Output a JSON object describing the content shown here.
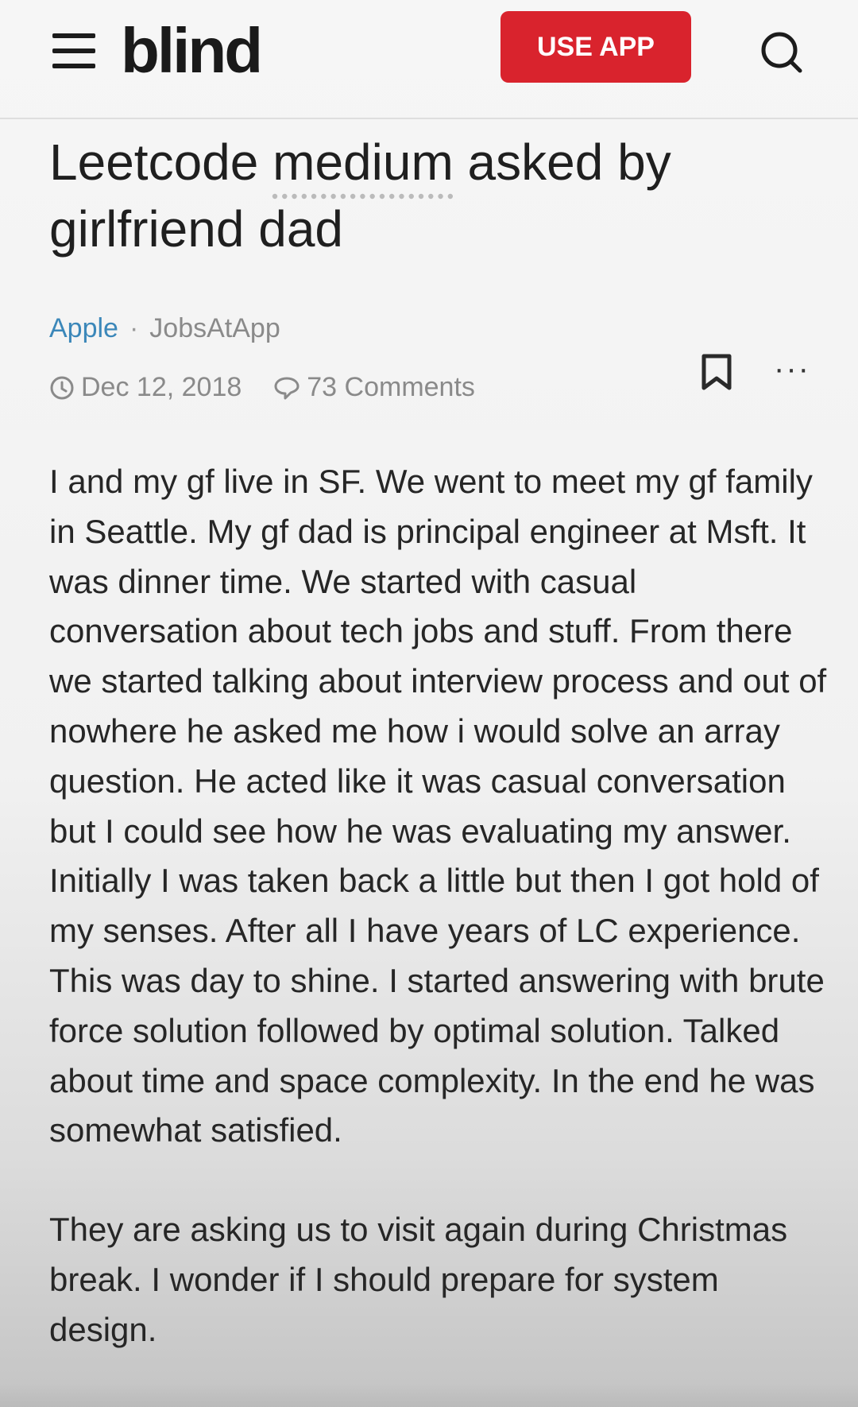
{
  "header": {
    "logo": "blind",
    "use_app_label": "USE APP"
  },
  "post": {
    "title_part1": "Leetcode ",
    "title_dotted": "medium",
    "title_part2": " asked by girlfriend dad",
    "company": "Apple",
    "separator": "·",
    "author": "JobsAtApp",
    "date": "Dec 12, 2018",
    "comments": "73 Comments",
    "more": "···",
    "paragraphs": [
      "I and my gf live in SF. We went to meet my gf family in Seattle. My gf dad is principal engineer at Msft. It was dinner time. We started with casual conversation about tech jobs and stuff. From there we started talking about interview process and out of nowhere he asked me how i would solve an array question. He acted like it was casual conversation but I could see how he was evaluating my answer. Initially I was taken back a little but then I got hold of my senses. After all I have years of LC experience. This was day to shine. I started answering with brute force solution followed by optimal solution. Talked about time and space complexity. In the end he was somewhat satisfied.",
      "They are asking us to visit again during Christmas break. I wonder if I should prepare for system design."
    ]
  },
  "colors": {
    "accent_red": "#d9232d",
    "company_blue": "#3b87b9",
    "meta_gray": "#8a8a8a"
  },
  "icons": [
    "menu-icon",
    "search-icon",
    "clock-icon",
    "comment-icon",
    "bookmark-icon",
    "more-icon"
  ]
}
